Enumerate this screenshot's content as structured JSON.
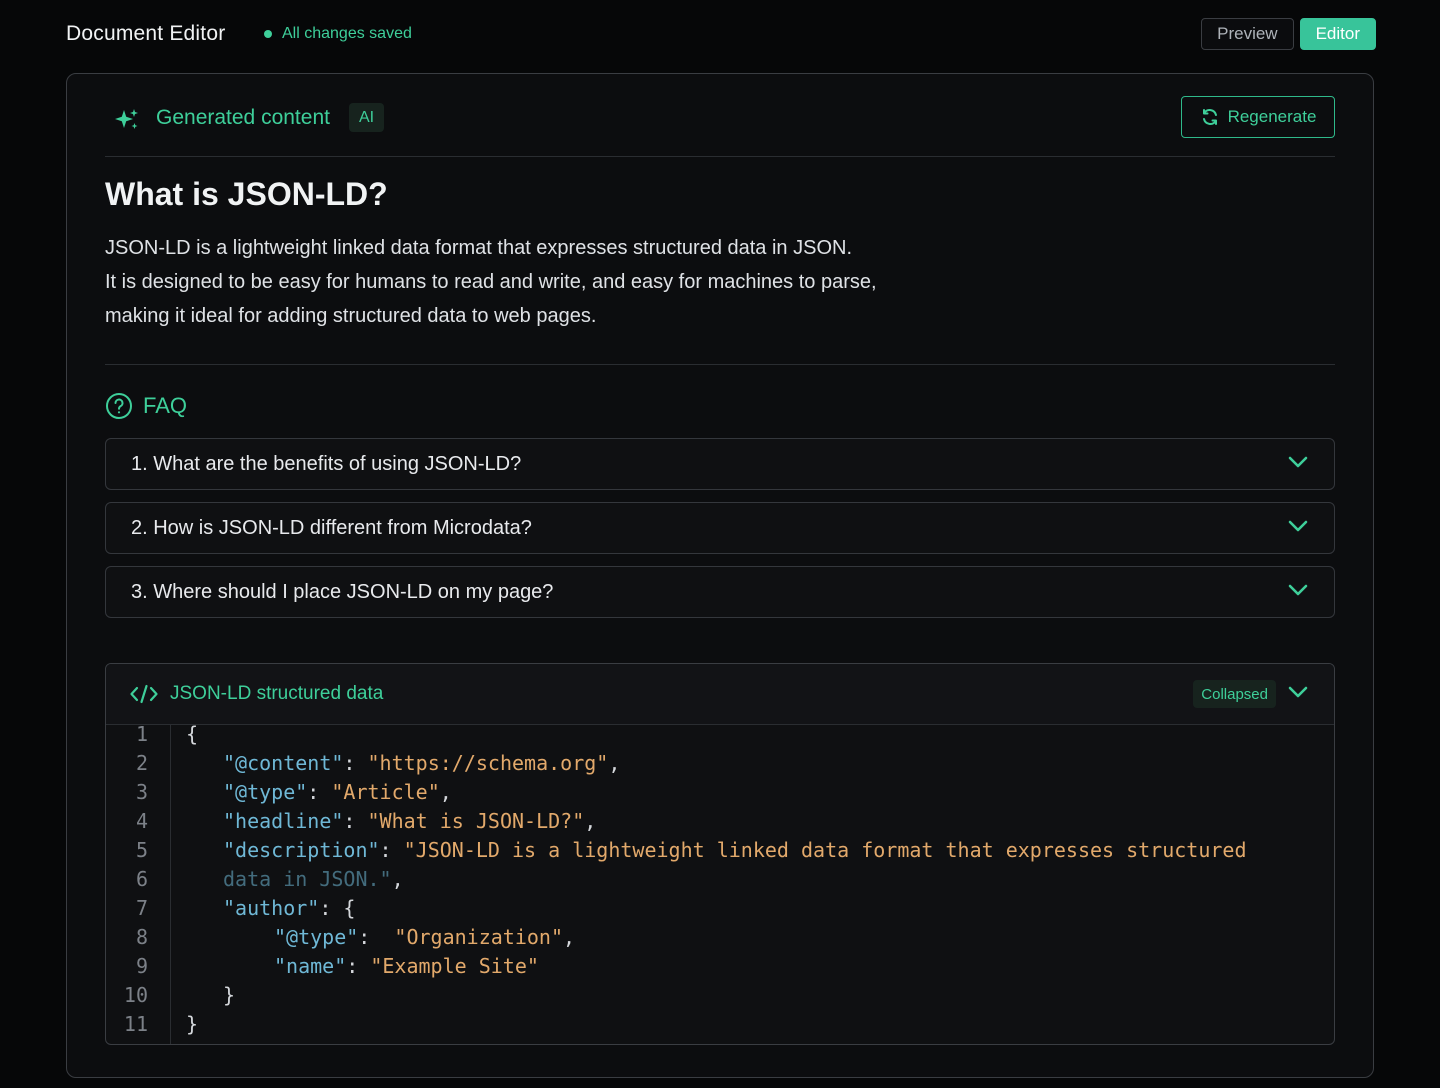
{
  "header": {
    "title": "Document Editor",
    "save_status": "All changes saved",
    "preview_label": "Preview",
    "editor_label": "Editor",
    "active_mode": "Editor"
  },
  "generated": {
    "title": "Generated content",
    "badge": "AI",
    "regenerate_label": "Regenerate"
  },
  "article": {
    "heading": "What is JSON-LD?",
    "lines": [
      "JSON-LD is a lightweight linked data format that expresses structured data in JSON.",
      "It is designed to be easy for humans to read and write, and easy for machines to parse,",
      "making it ideal for adding structured data to web pages."
    ]
  },
  "faq": {
    "title": "FAQ",
    "items": [
      "1. What are the benefits of using JSON-LD?",
      "2. How is JSON-LD different from Microdata?",
      "3. Where should I place JSON-LD on my page?"
    ]
  },
  "code": {
    "title": "JSON-LD structured data",
    "status_badge": "Collapsed",
    "line_numbers": [
      "1",
      "2",
      "3",
      "4",
      "5",
      "6",
      "7",
      "8",
      "9",
      "10",
      "11"
    ],
    "lines": [
      [
        {
          "t": "{",
          "c": "p"
        }
      ],
      [
        {
          "t": "\"@content\"",
          "c": "k"
        },
        {
          "t": ": ",
          "c": "p"
        },
        {
          "t": "\"https://schema.org\"",
          "c": "s"
        },
        {
          "t": ",",
          "c": "p"
        }
      ],
      [
        {
          "t": "\"@type\"",
          "c": "k"
        },
        {
          "t": ": ",
          "c": "p"
        },
        {
          "t": "\"Article\"",
          "c": "s"
        },
        {
          "t": ",",
          "c": "p"
        }
      ],
      [
        {
          "t": "\"headline\"",
          "c": "k"
        },
        {
          "t": ": ",
          "c": "p"
        },
        {
          "t": "\"What is JSON-LD?\"",
          "c": "s"
        },
        {
          "t": ",",
          "c": "p"
        }
      ],
      [
        {
          "t": "\"description\"",
          "c": "k"
        },
        {
          "t": ": ",
          "c": "p"
        },
        {
          "t": "\"JSON-LD is a lightweight linked data format that expresses structured",
          "c": "s"
        }
      ],
      [
        {
          "t": "data in JSON.\"",
          "c": "k fade"
        },
        {
          "t": ",",
          "c": "p"
        }
      ],
      [
        {
          "t": "\"author\"",
          "c": "k"
        },
        {
          "t": ": {",
          "c": "p"
        }
      ],
      [
        {
          "t": "\"@type\"",
          "c": "k"
        },
        {
          "t": ":  ",
          "c": "p"
        },
        {
          "t": "\"Organization\"",
          "c": "s"
        },
        {
          "t": ",",
          "c": "p"
        }
      ],
      [
        {
          "t": "\"name\"",
          "c": "k"
        },
        {
          "t": ": ",
          "c": "p"
        },
        {
          "t": "\"Example Site\"",
          "c": "s"
        }
      ],
      [
        {
          "t": "}",
          "c": "p"
        }
      ],
      [
        {
          "t": "}",
          "c": "p"
        }
      ]
    ]
  },
  "colors": {
    "accent": "#3ecf9a",
    "background": "#060708",
    "code_key": "#6fb8d6",
    "code_string": "#e2a96b"
  },
  "icons": [
    "sparkle-icon",
    "refresh-icon",
    "help-circle-icon",
    "chevron-down-icon",
    "code-icon"
  ]
}
